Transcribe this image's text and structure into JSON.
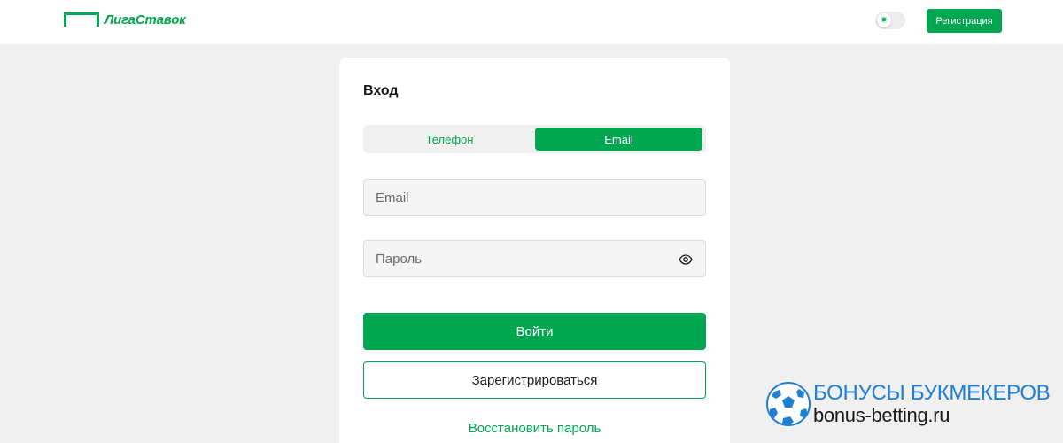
{
  "header": {
    "logo_text": "ЛигаСтавок",
    "register_label": "Регистрация",
    "theme_toggle_icon": "sun-icon"
  },
  "login": {
    "title": "Вход",
    "tabs": [
      {
        "label": "Телефон",
        "active": false
      },
      {
        "label": "Email",
        "active": true
      }
    ],
    "email_placeholder": "Email",
    "password_placeholder": "Пароль",
    "password_visibility_icon": "eye-icon",
    "submit_label": "Войти",
    "register_label": "Зарегистрироваться",
    "restore_label": "Восстановить пароль"
  },
  "watermark": {
    "line1": "БОНУСЫ БУКМЕКЕРОВ",
    "line2": "bonus-betting.ru"
  },
  "colors": {
    "brand_green": "#00a650",
    "page_background": "#f0f0f0",
    "watermark_blue": "#1e7fd6"
  }
}
